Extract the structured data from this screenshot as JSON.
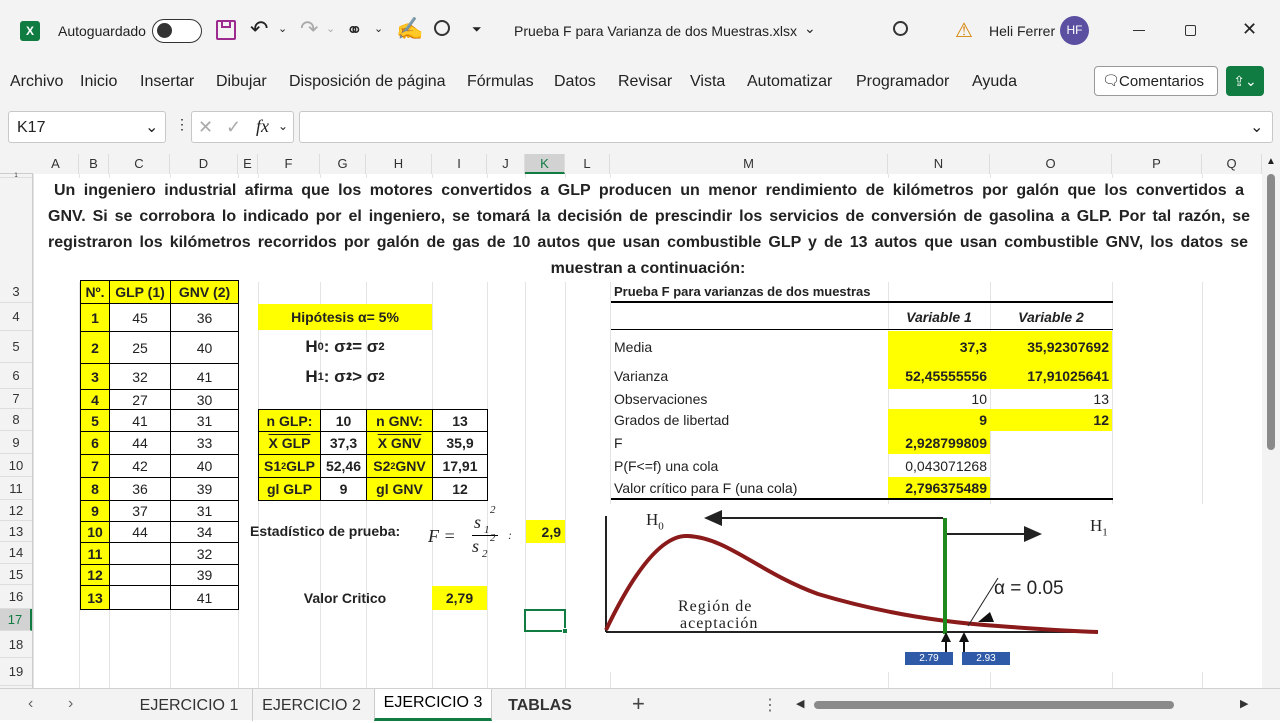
{
  "titlebar": {
    "autosave": "Autoguardado",
    "filename": "Prueba F para Varianza de dos Muestras.xlsx",
    "user": "Heli Ferrer",
    "initials": "HF"
  },
  "menu": [
    "Archivo",
    "Inicio",
    "Insertar",
    "Dibujar",
    "Disposición de página",
    "Fórmulas",
    "Datos",
    "Revisar",
    "Vista",
    "Automatizar",
    "Programador",
    "Ayuda"
  ],
  "comments_label": "Comentarios",
  "namebox": "K17",
  "fx": "fx",
  "columns": [
    "A",
    "B",
    "C",
    "D",
    "E",
    "F",
    "G",
    "H",
    "I",
    "J",
    "K",
    "L",
    "M",
    "N",
    "O",
    "P",
    "Q"
  ],
  "rows": [
    "1",
    "2",
    "3",
    "4",
    "5",
    "6",
    "7",
    "8",
    "9",
    "10",
    "11",
    "12",
    "13",
    "14",
    "15",
    "16",
    "17",
    "18",
    "19"
  ],
  "problem": [
    "Un ingeniero industrial afirma que los motores convertidos a GLP producen un menor rendimiento de kilómetros por galón que los convertidos a",
    "GNV. Si se corrobora lo indicado por el ingeniero, se tomará la decisión de prescindir los servicios de conversión de gasolina a GLP. Por tal razón, se",
    "registraron los kilómetros recorridos por galón de gas de 10 autos que usan combustible GLP y de 13 autos que usan combustible GNV, los datos se",
    "muestran a continuación:"
  ],
  "data_table": {
    "headers": [
      "Nº.",
      "GLP (1)",
      "GNV (2)"
    ],
    "rows": [
      [
        "1",
        "45",
        "36"
      ],
      [
        "2",
        "25",
        "40"
      ],
      [
        "3",
        "32",
        "41"
      ],
      [
        "4",
        "27",
        "30"
      ],
      [
        "5",
        "41",
        "31"
      ],
      [
        "6",
        "44",
        "33"
      ],
      [
        "7",
        "42",
        "40"
      ],
      [
        "8",
        "36",
        "39"
      ],
      [
        "9",
        "37",
        "31"
      ],
      [
        "10",
        "44",
        "34"
      ],
      [
        "11",
        "",
        "32"
      ],
      [
        "12",
        "",
        "39"
      ],
      [
        "13",
        "",
        "41"
      ]
    ]
  },
  "hypothesis": {
    "title": "Hipótesis  α= 5%",
    "h0": "H",
    "h0_sub": "0",
    "h0_rest": ": σ",
    "h0_a": "1",
    "h0_eq": " = σ",
    "h0_b": "2",
    "h1": "H",
    "h1_sub": "1",
    "h1_rest": ": σ",
    "h1_a": "1",
    "h1_gt": " > σ",
    "h1_b": "2",
    "sq": "2"
  },
  "stats": {
    "n_glp_label": "n GLP:",
    "n_glp": "10",
    "n_gnv_label": "n GNV:",
    "n_gnv": "13",
    "mean_glp_label": "X GLP",
    "mean_glp": "37,3",
    "mean_gnv_label": "X GNV",
    "mean_gnv": "35,9",
    "var_glp_label": "S1",
    "var_glp_label2": " GLP",
    "var_glp": "52,46",
    "var_gnv_label": "S2",
    "var_gnv_label2": " GNV",
    "var_gnv": "17,91",
    "gl_glp_label": "gl GLP",
    "gl_glp": "9",
    "gl_gnv_label": "gl GNV",
    "gl_gnv": "12"
  },
  "test_stat": {
    "label": "Estadístico de prueba:",
    "formula_f": "F =",
    "num": "s",
    "num_sub": "1",
    "den": "s",
    "den_sub": "2",
    "sq": "2",
    "value": "2,9"
  },
  "critical": {
    "label": "Valor Critico",
    "value": "2,79"
  },
  "ftest": {
    "title": "Prueba F para varianzas de dos muestras",
    "col1": "Variable 1",
    "col2": "Variable 2",
    "rows": [
      {
        "label": "Media",
        "v1": "37,3",
        "v2": "35,92307692"
      },
      {
        "label": "Varianza",
        "v1": "52,45555556",
        "v2": "17,91025641"
      },
      {
        "label": "Observaciones",
        "v1": "10",
        "v2": "13"
      },
      {
        "label": "Grados de libertad",
        "v1": "9",
        "v2": "12"
      },
      {
        "label": "F",
        "v1": "2,928799809",
        "v2": ""
      },
      {
        "label": "P(F<=f) una cola",
        "v1": "0,043071268",
        "v2": ""
      },
      {
        "label": "Valor crítico para F (una cola)",
        "v1": "2,796375489",
        "v2": ""
      }
    ]
  },
  "figure": {
    "h0": "H",
    "h0_sub": "0",
    "h1": "H",
    "h1_sub": "1",
    "alpha": "α = 0.05",
    "region1": "Región de",
    "region2": "aceptación",
    "tick1": "2.79",
    "tick2": "2.93"
  },
  "sheets": [
    "EJERCICIO 1",
    "EJERCICIO 2",
    "EJERCICIO 3",
    "TABLAS"
  ],
  "colors": {
    "excel_green": "#107c41",
    "highlight": "#ffff00",
    "curve": "#8b1a1a",
    "accept_line": "#1e8a1e"
  }
}
